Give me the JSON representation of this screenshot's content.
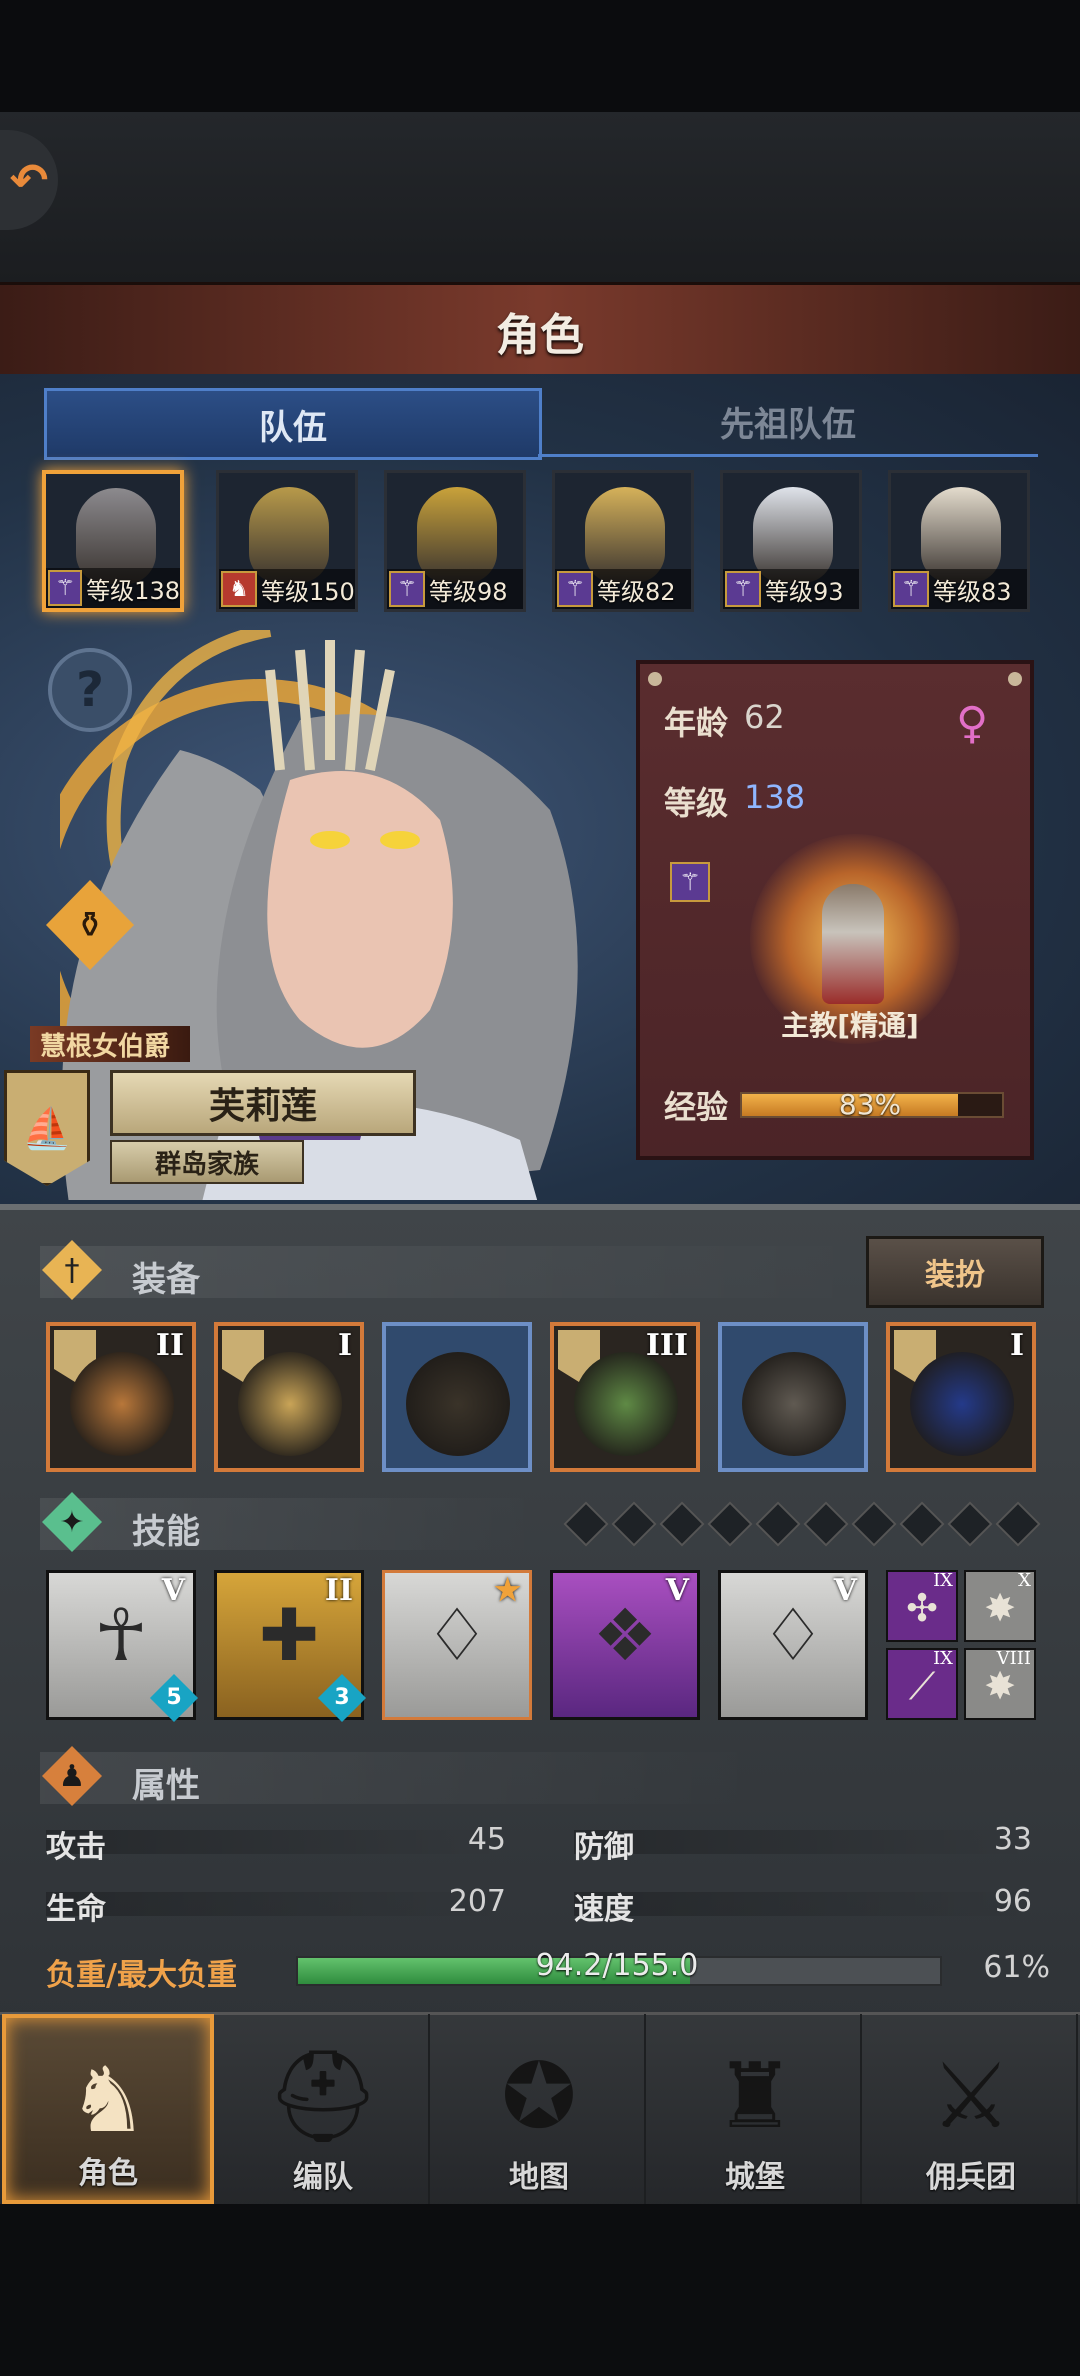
{
  "header": {
    "title": "角色"
  },
  "tabs": [
    {
      "label": "队伍"
    },
    {
      "label": "先祖队伍"
    }
  ],
  "roster": [
    {
      "level_text": "等级138",
      "class_icon": "staff-icon",
      "face_color": "#8c8a8e"
    },
    {
      "level_text": "等级150",
      "class_icon": "horse-icon",
      "face_color": "#b89a4a"
    },
    {
      "level_text": "等级98",
      "class_icon": "staff-icon",
      "face_color": "#c9a23a"
    },
    {
      "level_text": "等级82",
      "class_icon": "staff-icon",
      "face_color": "#d6b25a"
    },
    {
      "level_text": "等级93",
      "class_icon": "staff-icon",
      "face_color": "#dfe3ea"
    },
    {
      "level_text": "等级83",
      "class_icon": "staff-icon",
      "face_color": "#e4dccd"
    }
  ],
  "character": {
    "rank_title": "慧根女伯爵",
    "name": "芙莉莲",
    "family": "群岛家族"
  },
  "info": {
    "age_label": "年龄",
    "age": "62",
    "gender_icon": "♀",
    "level_label": "等级",
    "level": "138",
    "job": "主教[精通]",
    "exp_label": "经验",
    "exp_text": "83%",
    "exp_fraction": 0.83
  },
  "equipment": {
    "title": "装备",
    "dress_button": "装扮",
    "slots": [
      {
        "tier": "II",
        "color": "orange"
      },
      {
        "tier": "I",
        "color": "orange"
      },
      {
        "tier": "",
        "color": "blue"
      },
      {
        "tier": "III",
        "color": "orange"
      },
      {
        "tier": "",
        "color": "blue"
      },
      {
        "tier": "I",
        "color": "orange"
      }
    ]
  },
  "skills": {
    "title": "技能",
    "list": [
      {
        "tier": "V",
        "level": "5"
      },
      {
        "tier": "II",
        "level": "3"
      },
      {
        "tier": "",
        "level": ""
      },
      {
        "tier": "V",
        "level": ""
      },
      {
        "tier": "V",
        "level": ""
      }
    ],
    "mini": [
      {
        "tier": "IX"
      },
      {
        "tier": "X"
      },
      {
        "tier": "IX"
      },
      {
        "tier": "VIII"
      }
    ]
  },
  "attributes": {
    "title": "属性",
    "attack_label": "攻击",
    "attack": "45",
    "defense_label": "防御",
    "defense": "33",
    "hp_label": "生命",
    "hp": "207",
    "speed_label": "速度",
    "speed": "96",
    "load_label": "负重/最大负重",
    "load_text": "94.2/155.0",
    "load_percent": "61%",
    "load_fraction": 0.61
  },
  "nav": [
    {
      "label": "角色",
      "icon": "knight-icon"
    },
    {
      "label": "编队",
      "icon": "helmet-icon"
    },
    {
      "label": "地图",
      "icon": "compass-icon"
    },
    {
      "label": "城堡",
      "icon": "castle-icon"
    },
    {
      "label": "佣兵团",
      "icon": "mercenary-icon"
    }
  ]
}
